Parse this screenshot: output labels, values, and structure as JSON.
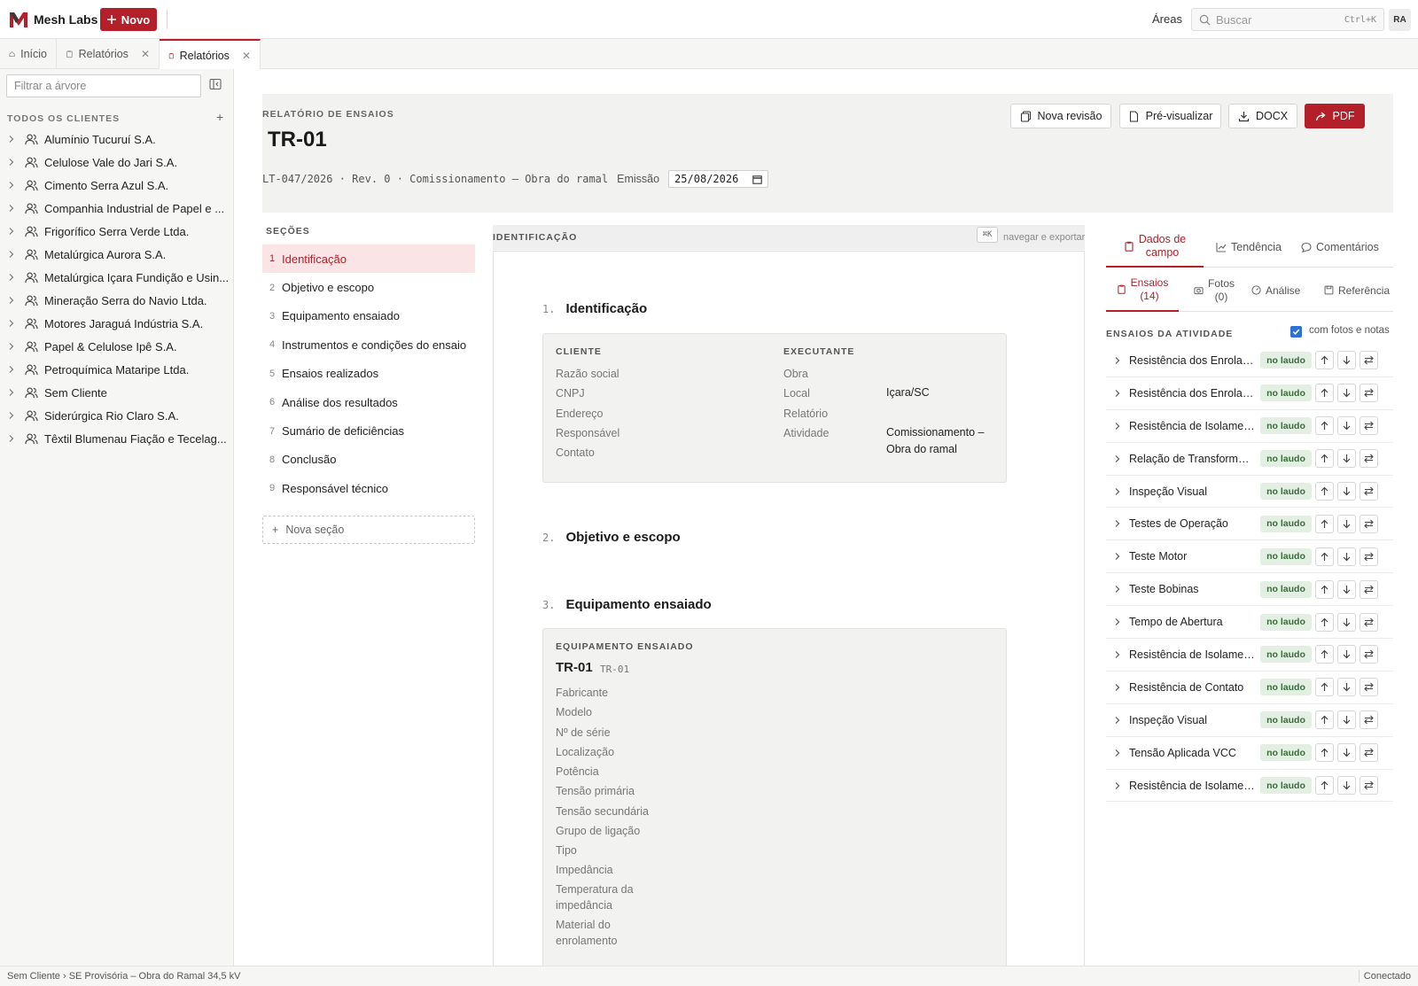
{
  "app": {
    "name": "Mesh Labs",
    "new_button": "Novo",
    "areas": "Áreas",
    "search_placeholder": "Buscar",
    "search_shortcut": "Ctrl+K",
    "user_initials": "RA",
    "accent_color": "#b3202a"
  },
  "tabs": [
    {
      "label": "Início",
      "icon": "home-icon",
      "closable": false,
      "active": false
    },
    {
      "label": "Relatórios",
      "icon": "clipboard-icon",
      "closable": true,
      "active": false
    },
    {
      "label": "Relatórios",
      "icon": "clipboard-icon",
      "closable": true,
      "active": true
    }
  ],
  "sidebar": {
    "filter_placeholder": "Filtrar a árvore",
    "heading": "TODOS OS CLIENTES",
    "add_label": "+",
    "clients": [
      "Alumínio Tucuruí S.A.",
      "Celulose Vale do Jari S.A.",
      "Cimento Serra Azul S.A.",
      "Companhia Industrial de Papel e ...",
      "Frigorífico Serra Verde Ltda.",
      "Metalúrgica Aurora S.A.",
      "Metalúrgica Içara Fundição e Usin...",
      "Mineração Serra do Navio Ltda.",
      "Motores Jaraguá Indústria S.A.",
      "Papel & Celulose Ipê S.A.",
      "Petroquímica Mataripe Ltda.",
      "Sem Cliente",
      "Siderúrgica Rio Claro S.A.",
      "Têxtil Blumenau Fiação e Tecelag..."
    ]
  },
  "report": {
    "kind": "RELATÓRIO DE ENSAIOS",
    "title": "TR-01",
    "meta": "LT-047/2026 · Rev. 0 · Comissionamento — Obra do ramal",
    "emission_label": "Emissão",
    "emission_date": "25/08/2026",
    "actions": {
      "new_revision": "Nova revisão",
      "preview": "Pré-visualizar",
      "docx": "DOCX",
      "pdf": "PDF"
    }
  },
  "sections": {
    "heading": "SEÇÕES",
    "items": [
      {
        "n": "1",
        "label": "Identificação",
        "active": true
      },
      {
        "n": "2",
        "label": "Objetivo e escopo",
        "active": false
      },
      {
        "n": "3",
        "label": "Equipamento ensaiado",
        "active": false
      },
      {
        "n": "4",
        "label": "Instrumentos e condições do ensaio",
        "active": false
      },
      {
        "n": "5",
        "label": "Ensaios realizados",
        "active": false
      },
      {
        "n": "6",
        "label": "Análise dos resultados",
        "active": false
      },
      {
        "n": "7",
        "label": "Sumário de deficiências",
        "active": false
      },
      {
        "n": "8",
        "label": "Conclusão",
        "active": false
      },
      {
        "n": "9",
        "label": "Responsável técnico",
        "active": false
      }
    ],
    "new_section": "Nova seção"
  },
  "document": {
    "bar_title": "IDENTIFICAÇÃO",
    "kbd": "⌘K",
    "hint": "navegar e exportar",
    "s1": {
      "n": "1.",
      "title": "Identificação"
    },
    "cliente": {
      "label": "CLIENTE",
      "fields": [
        "Razão social",
        "CNPJ",
        "Endereço",
        "Responsável",
        "Contato"
      ]
    },
    "executante": {
      "label": "EXECUTANTE",
      "fields": [
        "Obra",
        "Local",
        "Relatório",
        "Atividade"
      ],
      "local_value": "Içara/SC",
      "atividade_value_1": "Comissionamento –",
      "atividade_value_2": "Obra do ramal"
    },
    "s2": {
      "n": "2.",
      "title": "Objetivo e escopo"
    },
    "s3": {
      "n": "3.",
      "title": "Equipamento ensaiado"
    },
    "equipment": {
      "label": "EQUIPAMENTO ENSAIADO",
      "name": "TR-01",
      "tag": "TR-01",
      "fields": [
        "Fabricante",
        "Modelo",
        "Nº de série",
        "Localização",
        "Potência",
        "Tensão primária",
        "Tensão secundária",
        "Grupo de ligação",
        "Tipo",
        "Impedância",
        "Temperatura da",
        "impedância",
        "Material do",
        "enrolamento"
      ]
    }
  },
  "right_panel": {
    "tabs": [
      {
        "line1": "Dados de",
        "line2": "campo",
        "active": true
      },
      {
        "line1": "Tendência",
        "line2": "",
        "active": false
      },
      {
        "line1": "Comentários",
        "line2": "",
        "active": false
      }
    ],
    "subtabs": [
      {
        "line1": "Ensaios",
        "line2": "(14)",
        "active": true
      },
      {
        "line1": "Fotos",
        "line2": "(0)",
        "active": false
      },
      {
        "line1": "Análise",
        "line2": "",
        "active": false
      },
      {
        "line1": "Referência",
        "line2": "",
        "active": false
      }
    ],
    "activity_heading": "ENSAIOS DA ATIVIDADE",
    "with_photos_label": "com fotos e notas",
    "with_photos_checked": true,
    "badge_label": "no laudo",
    "tests": [
      "Resistência dos Enrolam...",
      "Resistência dos Enrolam...",
      "Resistência de Isolamen...",
      "Relação de Transformaç...",
      "Inspeção Visual",
      "Testes de Operação",
      "Teste Motor",
      "Teste Bobinas",
      "Tempo de Abertura",
      "Resistência de Isolamen...",
      "Resistência de Contato",
      "Inspeção Visual",
      "Tensão Aplicada VCC",
      "Resistência de Isolamen..."
    ]
  },
  "statusbar": {
    "breadcrumb": "Sem Cliente › SE Provisória – Obra do Ramal 34,5 kV",
    "connection": "Conectado"
  }
}
